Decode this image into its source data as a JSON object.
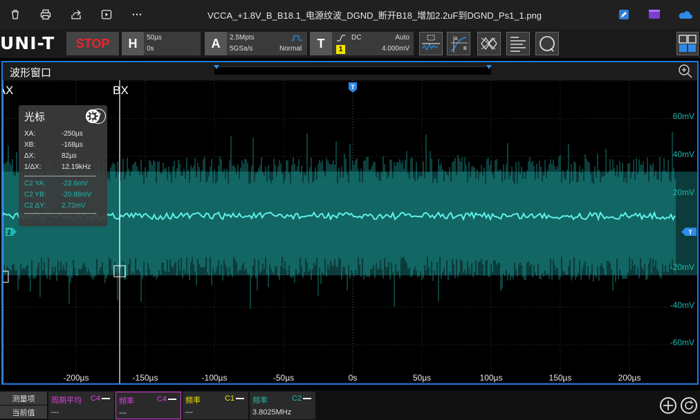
{
  "viewer": {
    "title": "VCCA_+1.8V_B_B18.1_电源纹波_DGND_断开B18_增加2.2uF到DGND_Ps1_1.png",
    "icons": [
      "delete-icon",
      "print-icon",
      "share-icon",
      "slideshow-icon",
      "more-icon",
      "edit-icon",
      "clipchamp-icon",
      "onedrive-icon"
    ]
  },
  "scope": {
    "logo": "UNI-T",
    "run_state": "STOP",
    "horizontal": {
      "letter": "H",
      "scale": "50µs",
      "offset": "0s"
    },
    "acquire": {
      "letter": "A",
      "memory": "2.5Mpts",
      "sample_rate": "5GSa/s",
      "mode": "Normal"
    },
    "trigger": {
      "letter": "T",
      "coupling": "DC",
      "source": "1",
      "sweep": "Auto",
      "level": "4.000mV"
    },
    "colors": {
      "ch2": "#1fb8b0",
      "ch1": "#f2e400",
      "ch4": "#e040e0",
      "accent": "#1e7be0",
      "stop": "#e8262b"
    }
  },
  "waveform_window": {
    "title": "波形窗口",
    "y_labels": [
      "60mV",
      "40mV",
      "20mV",
      "-20mV",
      "-40mV",
      "-60mV"
    ],
    "x_labels": [
      "-200µs",
      "-150µs",
      "-100µs",
      "-50µs",
      "0s",
      "50µs",
      "100µs",
      "150µs",
      "200µs"
    ],
    "cursor_a_label": "AX",
    "cursor_b_label": "BX",
    "trigger_marker": "T",
    "channel_marker": "2"
  },
  "cursor_panel": {
    "title": "光标",
    "rows": [
      {
        "k": "XA:",
        "v": "-250µs"
      },
      {
        "k": "XB:",
        "v": "-168µs"
      },
      {
        "k": "ΔX:",
        "v": "82µs"
      },
      {
        "k": "1/ΔX:",
        "v": "12.19kHz"
      }
    ],
    "ch_rows": [
      {
        "k": "C2 YA:",
        "v": "-23.6mV"
      },
      {
        "k": "C2 YB:",
        "v": "-20.88mV"
      },
      {
        "k": "C2 ΔY:",
        "v": "2.72mV"
      }
    ]
  },
  "measure": {
    "label_item": "测量项",
    "label_value": "当前值",
    "cells": [
      {
        "name": "周期平均",
        "src": "C4",
        "value": "---",
        "color": "#e040e0"
      },
      {
        "name": "频率",
        "src": "C4",
        "value": "---",
        "color": "#e040e0"
      },
      {
        "name": "频率",
        "src": "C1",
        "value": "---",
        "color": "#f2e400"
      },
      {
        "name": "频率",
        "src": "C2",
        "value": "3.8025MHz",
        "color": "#1fb8b0"
      }
    ]
  }
}
